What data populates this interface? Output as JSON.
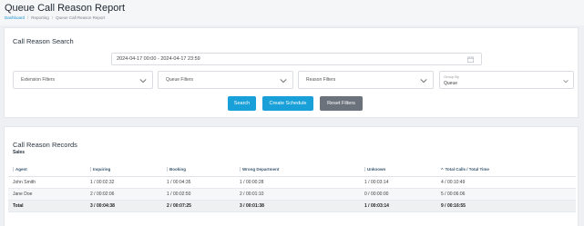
{
  "header": {
    "title": "Queue Call Reason Report",
    "breadcrumb": [
      "Dashboard",
      "Reporting",
      "Queue Call Reason Report"
    ]
  },
  "search": {
    "title": "Call Reason Search",
    "date_range": "2024-04-17 00:00 - 2024-04-17 23:59",
    "extension_filters": "Extension Filters",
    "queue_filters": "Queue Filters",
    "reason_filters": "Reason Filters",
    "group_by_label": "Group By",
    "group_by_value": "Queue",
    "search_btn": "Search",
    "schedule_btn": "Create Schedule",
    "reset_btn": "Reset Filters"
  },
  "records": {
    "title": "Call Reason Records",
    "subtitle": "Sales",
    "columns": [
      "Agent",
      "Inquiring",
      "Booking",
      "Wrong Department",
      "Unknown",
      "Total Calls / Total Time"
    ],
    "rows": [
      [
        "John Smith",
        "1 / 00:02:32",
        "1 / 00:04:35",
        "1 / 00:00:28",
        "1 / 00:03:14",
        "4 / 00:10:49"
      ],
      [
        "Jane Doe",
        "2 / 00:02:06",
        "1 / 00:02:50",
        "2 / 00:01:10",
        "0 / 00:00:00",
        "5 / 00:06:06"
      ]
    ],
    "total": [
      "Total",
      "3 / 00:04:38",
      "2 / 00:07:25",
      "3 / 00:01:38",
      "1 / 00:03:14",
      "9 / 00:16:55"
    ]
  },
  "colors": {
    "accent": "#1aa0d8",
    "reset": "#6b727b",
    "header_text": "#3b5870"
  },
  "icons": {
    "date": "calendar-icon",
    "dropdown": "chevron-down-icon",
    "sort": "sort-asc-icon"
  }
}
